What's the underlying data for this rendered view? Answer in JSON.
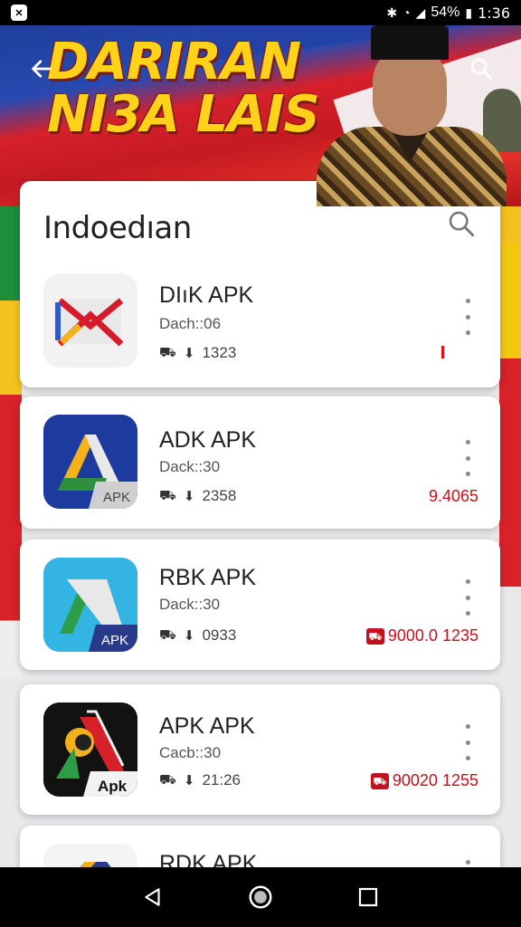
{
  "status_bar": {
    "battery_percent": "54%",
    "time": "1:36",
    "icons": [
      "bluetooth-icon",
      "wifi-icon",
      "signal-icon",
      "battery-icon"
    ]
  },
  "header": {
    "title_line1": "DARIRAN",
    "title_line2": "NI3A LAIS",
    "back_icon": "arrow-left-icon",
    "search_icon": "search-icon"
  },
  "panel": {
    "title": "Indoedıan",
    "search_icon": "search-icon"
  },
  "apps": [
    {
      "name": "DIıK APK",
      "developer": "Dach::06",
      "size": "1323",
      "price": "",
      "icon": "envelope-x-icon"
    },
    {
      "name": "ADK APK",
      "developer": "Dack::30",
      "size": "2358",
      "price": "9.4065",
      "icon": "apk-a-icon"
    },
    {
      "name": "RBK APK",
      "developer": "Dack::30",
      "size": "0933",
      "price": "9000.0 1235",
      "icon": "apk-a-light-icon"
    },
    {
      "name": "APK APK",
      "developer": "Cacb::30",
      "size": "21:26",
      "price": "90020 1255",
      "icon": "apk-dark-icon"
    },
    {
      "name": "RDK APK",
      "developer": "",
      "size": "",
      "price": "",
      "icon": "apk-partial-icon"
    }
  ],
  "nav": {
    "back": "nav-back-icon",
    "home": "nav-home-icon",
    "recents": "nav-recents-icon"
  },
  "colors": {
    "accent_red": "#c3121e",
    "banner_blue": "#2849b0",
    "banner_yellow": "#ffd21a"
  }
}
